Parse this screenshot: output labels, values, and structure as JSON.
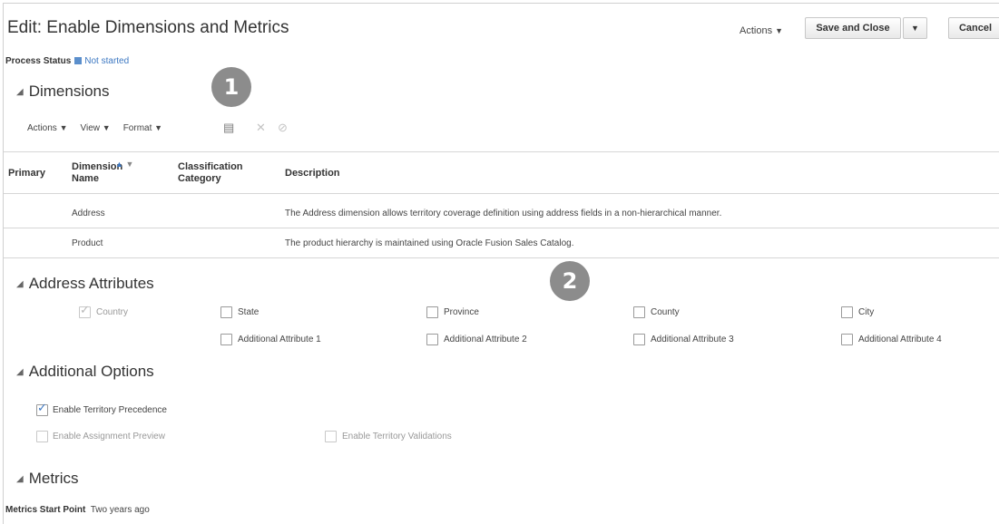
{
  "header": {
    "title": "Edit: Enable Dimensions and Metrics",
    "actions_label": "Actions",
    "save_close_label": "Save and Close",
    "cancel_label": "Cancel"
  },
  "process_status": {
    "label": "Process Status",
    "value": "Not started"
  },
  "badges": [
    "1",
    "2"
  ],
  "dimensions": {
    "heading": "Dimensions",
    "toolbar": {
      "actions": "Actions",
      "view": "View",
      "format": "Format"
    },
    "columns": [
      "Primary",
      "Dimension Name",
      "Classification Category",
      "Description"
    ],
    "rows": [
      {
        "name": "Address",
        "category": "",
        "description": "The Address dimension allows territory coverage definition using address fields in a non-hierarchical manner."
      },
      {
        "name": "Product",
        "category": "",
        "description": "The product hierarchy is maintained using Oracle Fusion Sales Catalog."
      }
    ]
  },
  "address_attributes": {
    "heading": "Address Attributes",
    "row1": [
      {
        "label": "Country",
        "checked": true,
        "disabled": true
      },
      {
        "label": "State",
        "checked": false,
        "disabled": false
      },
      {
        "label": "Province",
        "checked": false,
        "disabled": false
      },
      {
        "label": "County",
        "checked": false,
        "disabled": false
      },
      {
        "label": "City",
        "checked": false,
        "disabled": false
      }
    ],
    "row2": [
      {
        "label": "Additional Attribute 1",
        "checked": false
      },
      {
        "label": "Additional Attribute 2",
        "checked": false
      },
      {
        "label": "Additional Attribute 3",
        "checked": false
      },
      {
        "label": "Additional Attribute 4",
        "checked": false
      }
    ]
  },
  "additional_options": {
    "heading": "Additional Options",
    "enable_precedence": "Enable Territory Precedence",
    "enable_preview": "Enable Assignment Preview",
    "enable_validations": "Enable Territory Validations"
  },
  "metrics": {
    "heading": "Metrics",
    "start_point_label": "Metrics Start Point",
    "start_point_value": "Two years ago"
  },
  "colors": {
    "accent": "#3d78c2",
    "badge": "#8c8c8c"
  }
}
